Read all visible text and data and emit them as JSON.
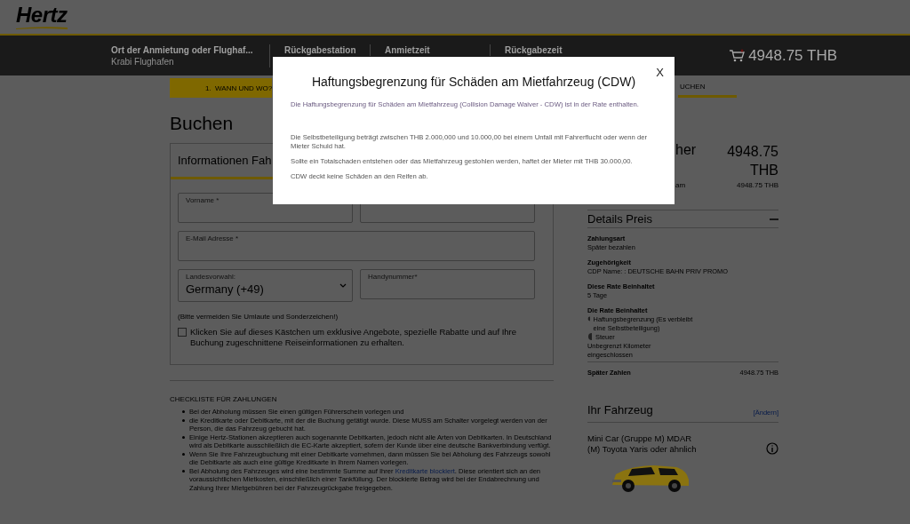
{
  "header": {
    "logo": "Hertz",
    "fields": [
      {
        "label": "Ort der Anmietung oder Flughaf...",
        "value": "Krabi Flughafen"
      },
      {
        "label": "Rückgabestation"
      },
      {
        "label": "Anmietzeit"
      },
      {
        "label": "Rückgabezeit"
      }
    ],
    "cart_total": "4948.75 THB"
  },
  "steps": [
    {
      "label": "1.  WANN UND WO?",
      "kind": "done"
    },
    {
      "label": "UCHEN",
      "kind": "current"
    }
  ],
  "page_title": "Buchen",
  "form": {
    "tab": "Informationen Fah",
    "fields": [
      {
        "label": "Vorname *",
        "kind": "text"
      },
      {
        "kind": "text"
      },
      {
        "label": "E-Mail Adresse *",
        "kind": "text"
      },
      {
        "label": "Landesvorwahl:",
        "value": "Germany (+49)",
        "kind": "select"
      },
      {
        "label": "Handynummer*",
        "kind": "text"
      }
    ],
    "note": "(Bitte vermeiden Sie Umlaute und Sonderzeichen!)",
    "newsletter": {
      "label": "Klicken Sie auf dieses Kästchen um exklusive Angebote, spezielle Rabatte und auf Ihre Buchung zugeschnittene Reiseinformationen zu erhalten.",
      "checked": false
    }
  },
  "checklist": {
    "title": "CHECKLISTE FÜR ZAHLUNGEN",
    "items": [
      {
        "text": "Bei der Abholung müssen Sie einen gültigen Führerschein vorlegen und"
      },
      {
        "text": "die Kreditkarte oder Debitkarte, mit der die Buchung getätigt wurde. Diese MUSS am Schalter vorgelegt werden von der Person, die das Fahrzeug gebucht hat."
      },
      {
        "text": "Einige Hertz-Stationen akzeptieren auch sogenannte Debitkarten, jedoch nicht alle Arten von Debitkarten. In Deutschland wird als Debitkarte ausschließlich die EC-Karte akzeptiert, sofern der Kunde über eine deutsche Bankverbindung verfügt."
      },
      {
        "text": "Wenn Sie Ihre Fahrzeugbuchung mit einer Debitkarte vornehmen, dann müssen Sie bei Abholung des Fahrzeugs sowohl die Debitkarte als auch eine gültige Kreditkarte in Ihrem Namen vorlegen."
      },
      {
        "text": "Bei Abholung des Fahrzeuges wird eine bestimmte Summe auf Ihrer ",
        "link": "Kreditkarte blockiert",
        "after": ". Diese orientiert sich an den voraussichtlichen Mietkosten, einschließlich einer Tankfüllung. Der blockierte Betrag wird bei der Endabrechnung und Zahlung Ihrer Mietgebühren bei der Fahrzeugrückgabe freigegeben."
      }
    ]
  },
  "summary": {
    "title_fragment": "her",
    "total": "4948.75 THB",
    "note_fragment": "am",
    "subtotal": "4948.75 THB"
  },
  "price_details": {
    "title": "Details Preis",
    "expanded": true,
    "entries": [
      {
        "label": "Zahlungsart",
        "value": "Später bezahlen"
      },
      {
        "label": "Zugehörigkeit",
        "value": "CDP Name: : DEUTSCHE BAHN PRIV PROMO"
      },
      {
        "label": "Diese Rate Beinhaltet",
        "value": "5 Tage"
      },
      {
        "label": "Die Rate Beinhaltet",
        "items": [
          "Haftungsbegrenzung (Es verbleibt eine Selbstbeteiligung)",
          "Steuer"
        ],
        "value": "Unbegrenzt Kilometer eingeschlossen"
      }
    ],
    "total_label": "Später Zahlen",
    "total": "4948.75 THB"
  },
  "vehicle": {
    "title": "Ihr Fahrzeug",
    "change_link": "[Ändern]",
    "name": "Mini Car (Gruppe M) MDAR",
    "model": "(M) Toyota Yaris oder ähnlich"
  },
  "modal": {
    "title": "Haftungsbegrenzung für Schäden am Mietfahrzeug (CDW)",
    "close": "X",
    "paragraphs": [
      "Die Haftungsbegrenzung für Schäden am Mietfahrzeug (Collision Damage Waiver - CDW) ist in der Rate enthalten.",
      "Die Selbstbeteiligung beträgt zwischen THB 2.000,000 und 10.000,00 bei einem Unfall mit Fahrerflucht oder wenn der Mieter Schuld hat.",
      "Sollte ein Totalschaden entstehen oder das Mietfahrzeug gestohlen werden, haftet der Mieter mit THB 30.000,00.",
      "CDW deckt keine Schäden an den Reifen ab."
    ]
  }
}
